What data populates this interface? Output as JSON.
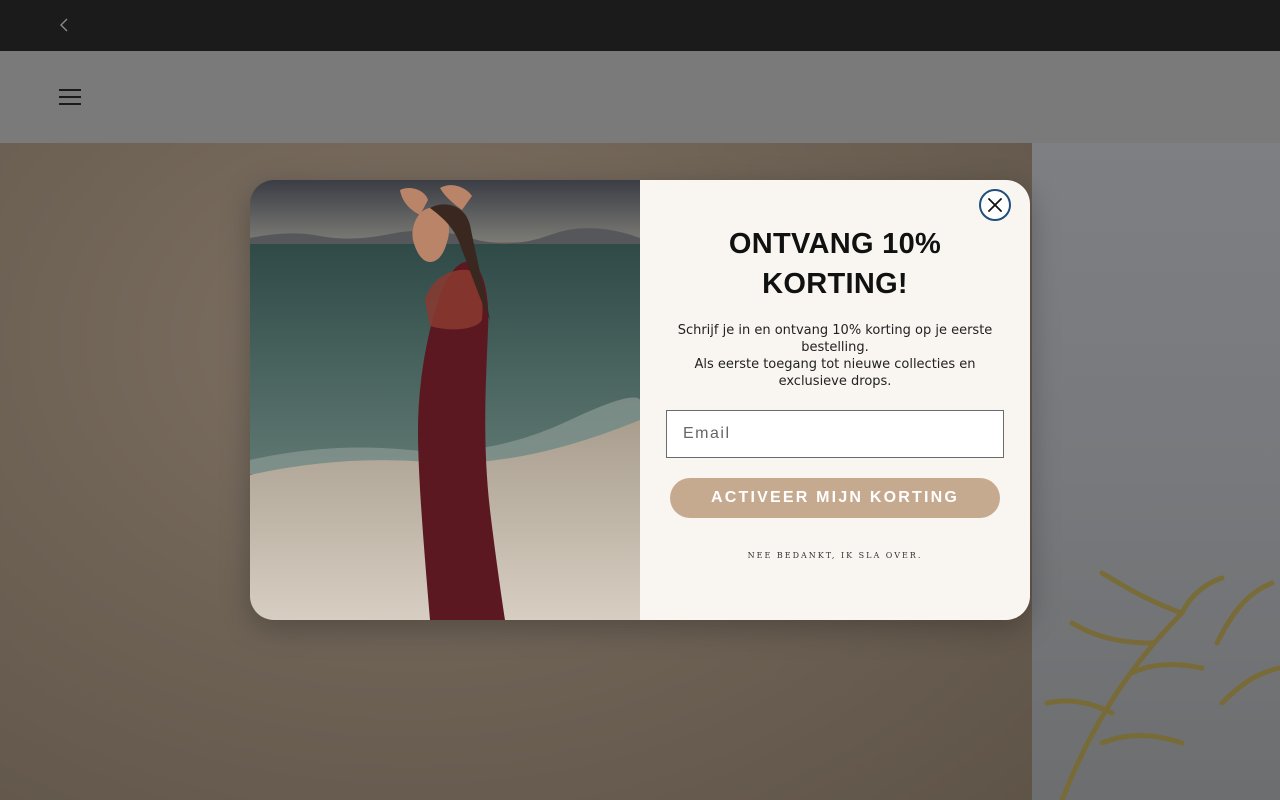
{
  "announcement": {
    "prev_icon": "chevron-left-icon"
  },
  "header": {
    "menu_icon": "hamburger-menu-icon"
  },
  "popup": {
    "close_icon": "close-icon",
    "title": "ONTVANG 10% KORTING!",
    "description_line1": "Schrijf je in en ontvang 10% korting op je eerste bestelling.",
    "description_line2": "Als eerste toegang tot nieuwe collecties en exclusieve drops.",
    "email_placeholder": "Email",
    "submit_label": "ACTIVEER MIJN KORTING",
    "decline_label": "NEE BEDANKT, IK SLA OVER."
  },
  "colors": {
    "announcement_bg": "#1b1b1b",
    "button_bg": "#c6aa8f",
    "panel_bg": "#f9f6f2",
    "close_border": "#1f4f7a"
  }
}
